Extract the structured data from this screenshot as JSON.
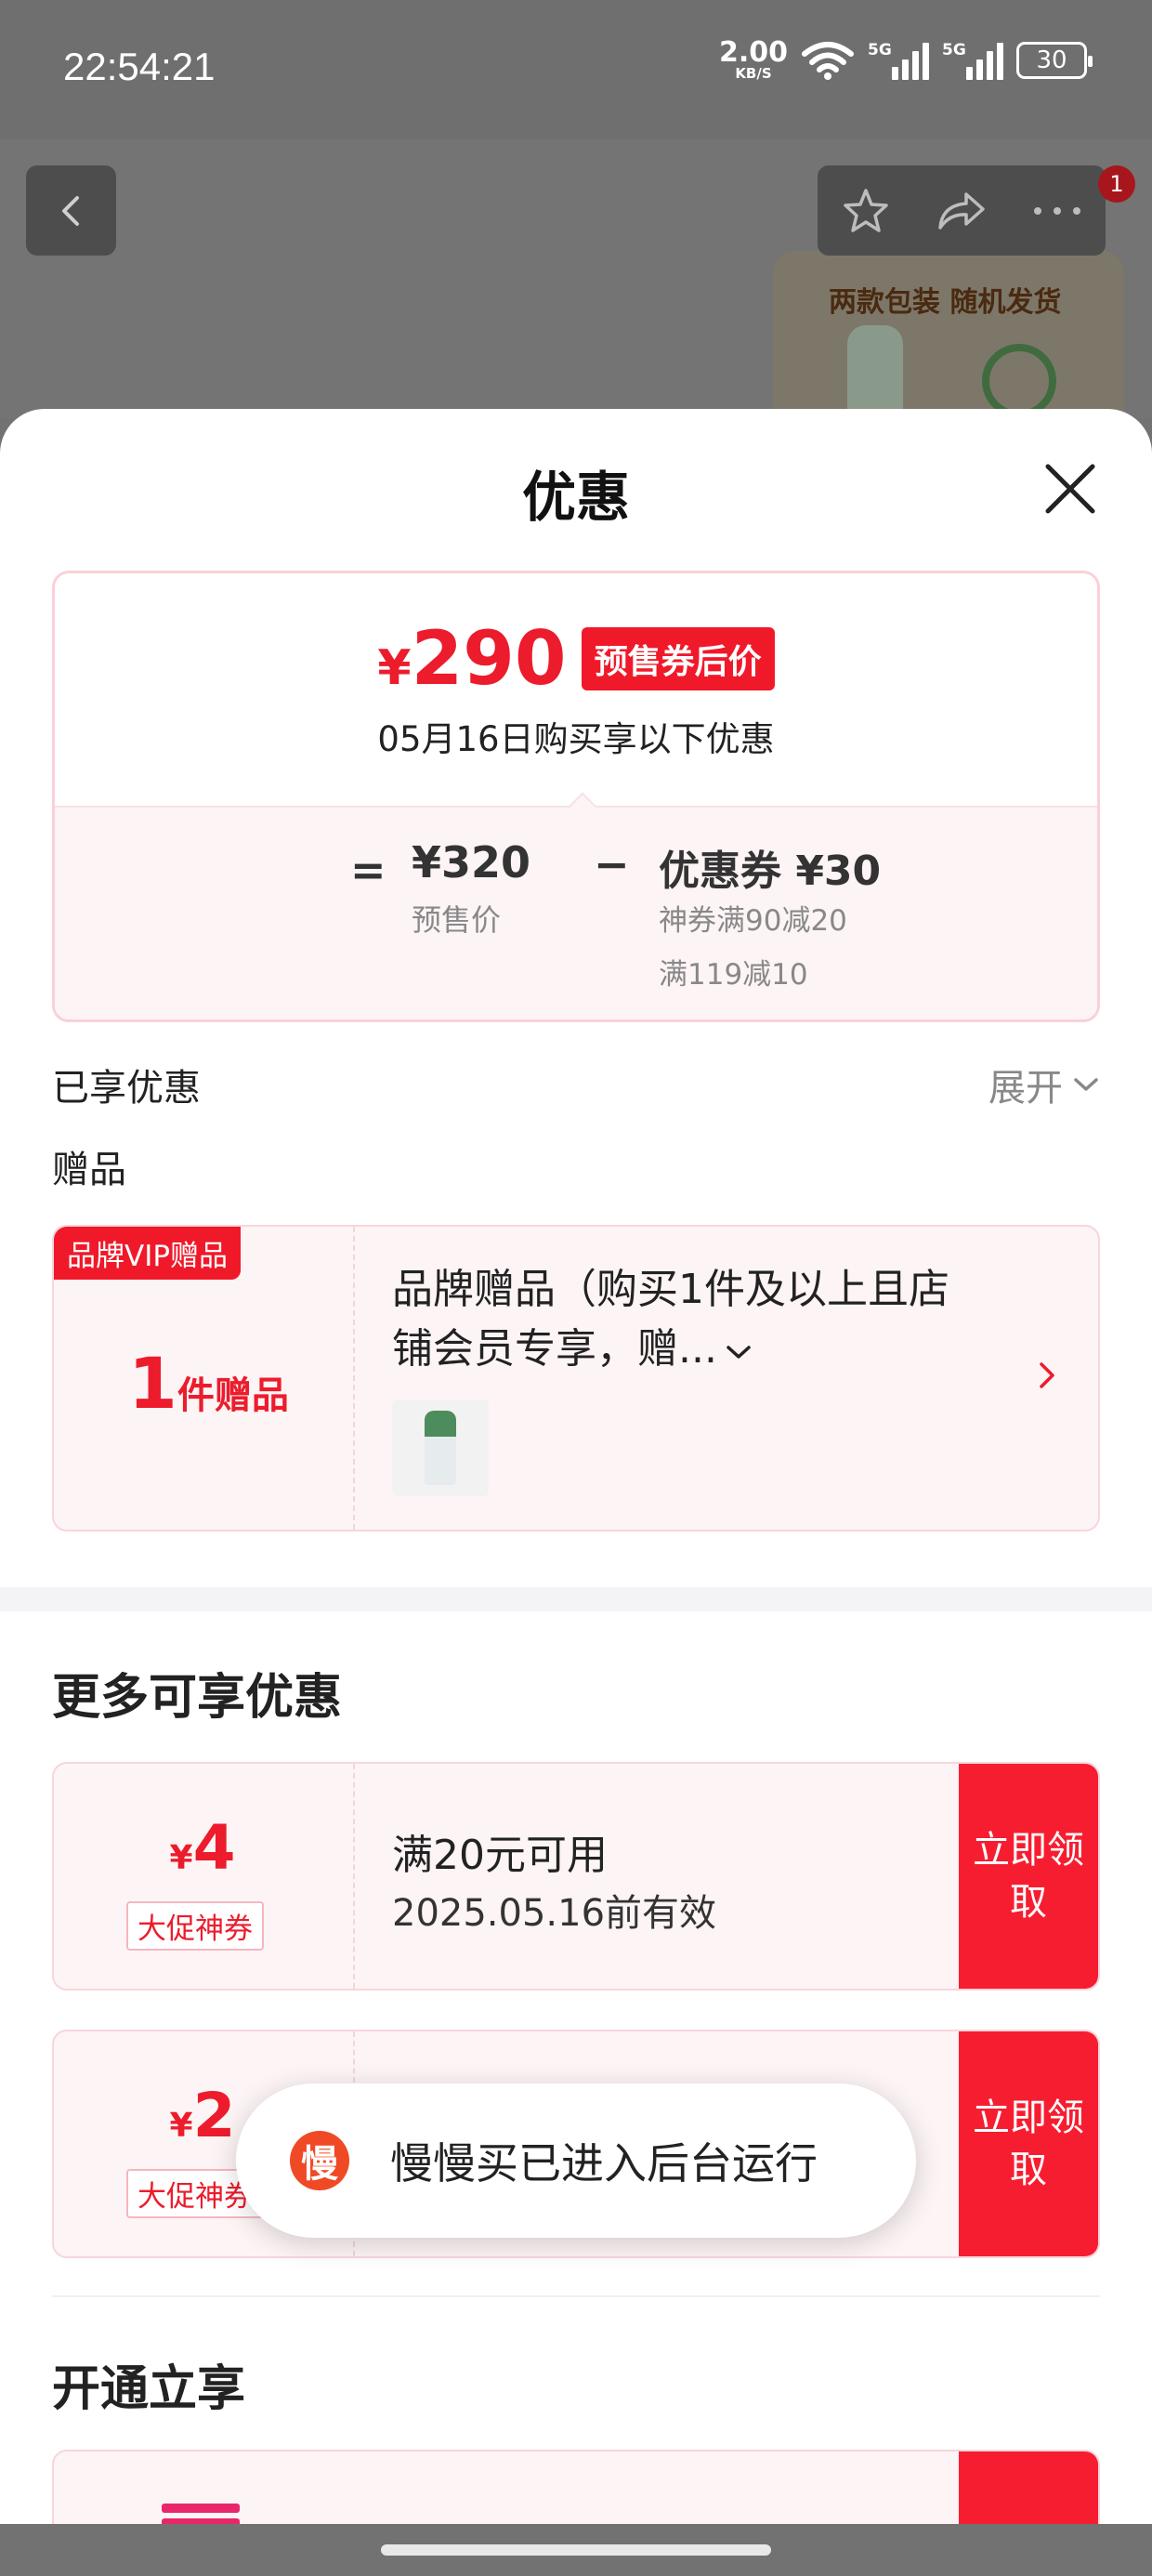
{
  "status_bar": {
    "time": "22:54:21",
    "net_speed": "2.00",
    "net_unit": "KB/S",
    "sim1": "5G",
    "sim2": "5G",
    "battery": "30"
  },
  "header": {
    "notification_count": "1",
    "product_banner": "两款包装 随机发货"
  },
  "sheet": {
    "title": "优惠",
    "price_card": {
      "currency": "¥",
      "final_price": "290",
      "price_tag": "预售券后价",
      "date_note": "05月16日购买享以下优惠",
      "equals": "=",
      "presale_price": "¥320",
      "presale_label": "预售价",
      "minus": "−",
      "coupon_total": "优惠券 ¥30",
      "coupon_detail_1": "神券满90减20",
      "coupon_detail_2": "满119减10"
    },
    "enjoyed_label": "已享优惠",
    "expand_label": "展开",
    "gift_label": "赠品",
    "gift_card": {
      "tag": "品牌VIP赠品",
      "count": "1",
      "count_unit": "件赠品",
      "description": "品牌赠品（购买1件及以上且店铺会员专享，赠..."
    },
    "more_title": "更多可享优惠",
    "coupons": [
      {
        "currency": "¥",
        "value": "4",
        "tag": "大促神券",
        "condition": "满20元可用",
        "expire": "2025.05.16前有效",
        "claim": "立即领取"
      },
      {
        "currency": "¥",
        "value": "2",
        "tag": "大促神券",
        "condition": "",
        "expire": "",
        "claim": "立即领取"
      }
    ],
    "open_title": "开通立享"
  },
  "toast": {
    "icon_char": "慢",
    "text": "慢慢买已进入后台运行"
  },
  "colors": {
    "accent_red": "#f0192a",
    "price_red": "#ec1c2c",
    "card_bg": "#fdf4f5"
  }
}
